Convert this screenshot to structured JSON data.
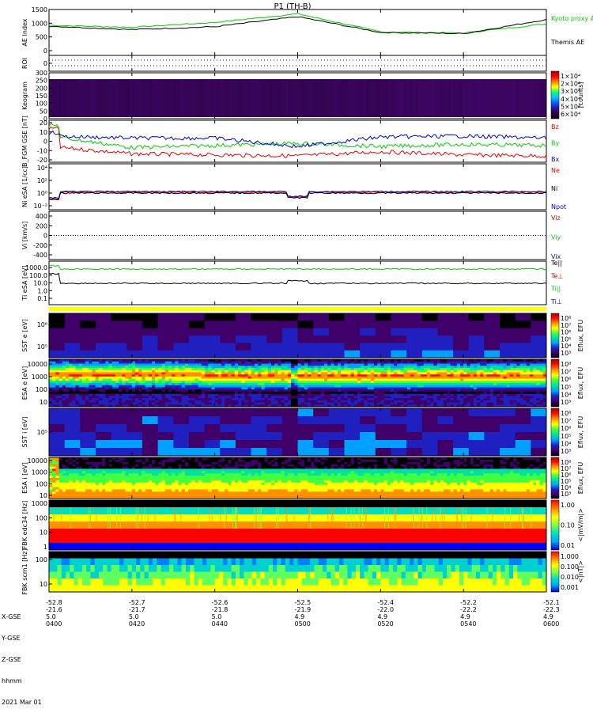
{
  "title": "P1 (TH-B)",
  "footer": {
    "row_labels": [
      "X-GSE",
      "Y-GSE",
      "Z-GSE",
      "hhmm",
      "2021 Mar 01"
    ],
    "columns": [
      {
        "x": "-52.8",
        "y": "-21.6",
        "z": "5.0",
        "t": "0400"
      },
      {
        "x": "-52.7",
        "y": "-21.7",
        "z": "5.0",
        "t": "0420"
      },
      {
        "x": "-52.6",
        "y": "-21.8",
        "z": "5.0",
        "t": "0440"
      },
      {
        "x": "-52.5",
        "y": "-21.9",
        "z": "4.9",
        "t": "0500"
      },
      {
        "x": "-52.4",
        "y": "-22.0",
        "z": "4.9",
        "t": "0520"
      },
      {
        "x": "-52.2",
        "y": "-22.2",
        "z": "4.9",
        "t": "0540"
      },
      {
        "x": "-52.1",
        "y": "-22.3",
        "z": "4.9",
        "t": "0600"
      }
    ]
  },
  "colors": {
    "red": "#e00000",
    "green": "#00cc00",
    "blue": "#0000cc",
    "black": "#000000",
    "yellow": "#ffff00"
  },
  "chart_data": [
    {
      "type": "line",
      "id": "ae",
      "ylabel": "AE Index",
      "yticks": [
        "0",
        "500",
        "1000",
        "1500"
      ],
      "ylim": [
        0,
        1600
      ],
      "x": [
        "0400",
        "0420",
        "0440",
        "0500",
        "0520",
        "0540",
        "0600"
      ],
      "series": [
        {
          "name": "Kyoto proxy AE",
          "color": "#00cc00",
          "values": [
            1050,
            980,
            1150,
            1450,
            820,
            780,
            1100
          ]
        },
        {
          "name": "Themis AE",
          "color": "#000000",
          "values": [
            1020,
            900,
            1000,
            1350,
            800,
            760,
            1250
          ]
        }
      ]
    },
    {
      "type": "line",
      "id": "roi",
      "ylabel": "ROI",
      "yticks": [
        "0"
      ]
    },
    {
      "type": "heatmap",
      "id": "keogram",
      "ylabel": "Keogram",
      "yticks": [
        "0",
        "50",
        "100",
        "150",
        "200",
        "250",
        "300"
      ],
      "colorbar": {
        "label": "[counts]",
        "ticks": [
          "1×10⁴",
          "2×10⁴",
          "3×10⁴",
          "4×10⁴",
          "5×10⁴",
          "6×10⁴"
        ]
      }
    },
    {
      "type": "line",
      "id": "bfgm",
      "ylabel": "B_FGM GSE [nT]",
      "yticks": [
        "20",
        "10",
        "0",
        "-10",
        "-20"
      ],
      "ylim": [
        -20,
        20
      ],
      "series": [
        {
          "name": "Bz",
          "color": "#e00000",
          "values": [
            -5,
            -12,
            -13,
            -14,
            -10,
            -13,
            -14
          ]
        },
        {
          "name": "By",
          "color": "#00cc00",
          "values": [
            5,
            -6,
            -4,
            -2,
            -5,
            -3,
            -4
          ]
        },
        {
          "name": "Bx",
          "color": "#0000cc",
          "values": [
            5,
            3,
            3,
            -5,
            4,
            5,
            3
          ]
        }
      ]
    },
    {
      "type": "line",
      "id": "ni",
      "ylabel": "Ni eSA [1/cc]",
      "yticks": [
        "10⁴",
        "10²",
        "10⁰",
        "10⁻²"
      ],
      "series": [
        {
          "name": "Ne",
          "color": "#e00000"
        },
        {
          "name": "Ni",
          "color": "#000000"
        },
        {
          "name": "Npot",
          "color": "#0000cc"
        }
      ]
    },
    {
      "type": "line",
      "id": "vi",
      "ylabel": "Vi [km/s]",
      "yticks": [
        "400",
        "200",
        "0",
        "-200",
        "-400"
      ],
      "ylim": [
        -450,
        450
      ],
      "series": [
        {
          "name": "Viz",
          "color": "#e00000"
        },
        {
          "name": "Viy",
          "color": "#00cc00"
        },
        {
          "name": "Vix",
          "color": "#0000cc"
        }
      ]
    },
    {
      "type": "line",
      "id": "ti",
      "ylabel": "Ti eSA [eV]",
      "yticks": [
        "1000.0",
        "100.0",
        "10.0",
        "1.0",
        "0.1"
      ],
      "series": [
        {
          "name": "Te||",
          "color": "#000000"
        },
        {
          "name": "Te⊥",
          "color": "#e00000"
        },
        {
          "name": "Ti||",
          "color": "#00cc00"
        },
        {
          "name": "Ti⊥",
          "color": "#0000cc"
        }
      ]
    },
    {
      "type": "heatmap",
      "id": "sst_e",
      "ylabel": "SST e [eV]",
      "yticks": [
        "10⁶",
        "10⁵"
      ],
      "colorbar": {
        "label": "Eflux, EFU",
        "ticks": [
          "10⁸",
          "10⁷",
          "10⁶",
          "10⁵",
          "10⁴",
          "10³"
        ]
      }
    },
    {
      "type": "heatmap",
      "id": "esa_e",
      "ylabel": "ESA e [eV]",
      "yticks": [
        "10000",
        "1000",
        "100",
        "10"
      ],
      "colorbar": {
        "label": "Eflux, EFU",
        "ticks": [
          "10⁸",
          "10⁷",
          "10⁶",
          "10⁵",
          "10⁴",
          "10³"
        ]
      }
    },
    {
      "type": "heatmap",
      "id": "sst_i",
      "ylabel": "SST i [eV]",
      "yticks": [
        "10⁵"
      ],
      "colorbar": {
        "label": "Eflux, EFU",
        "ticks": [
          "10⁸",
          "10⁷",
          "10⁶",
          "10⁵",
          "10⁴",
          "10³"
        ]
      }
    },
    {
      "type": "heatmap",
      "id": "esa_i",
      "ylabel": "ESA i [eV]",
      "yticks": [
        "10000",
        "1000",
        "100",
        "10"
      ],
      "colorbar": {
        "label": "Eflux, EFU",
        "ticks": [
          "10⁸",
          "10⁷",
          "10⁶",
          "10⁵",
          "10⁴",
          "10³"
        ]
      }
    },
    {
      "type": "heatmap",
      "id": "fbk_edc",
      "ylabel": "FBK edc34 [Hz]",
      "yticks": [
        "1000",
        "100",
        "10",
        "1"
      ],
      "colorbar": {
        "label": "<|mV/m|>",
        "ticks": [
          "1.00",
          "0.10",
          "0.01"
        ]
      }
    },
    {
      "type": "heatmap",
      "id": "fbk_scm",
      "ylabel": "FBK scm1 [Hz]",
      "yticks": [
        "100",
        "10"
      ],
      "colorbar": {
        "label": "<|nT|>",
        "ticks": [
          "1.000",
          "0.100",
          "0.010",
          "0.001"
        ]
      }
    }
  ]
}
